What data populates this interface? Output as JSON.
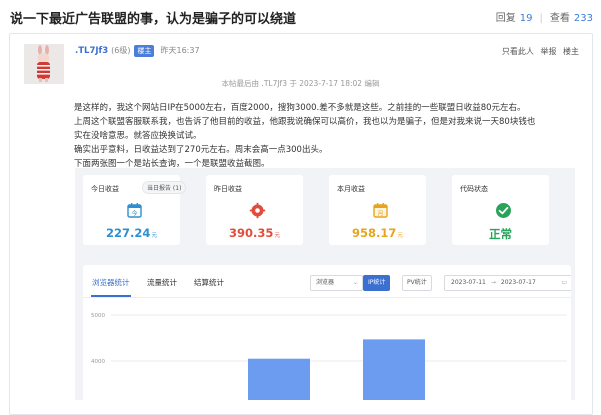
{
  "thread": {
    "title": "说一下最近广告联盟的事，认为是骗子的可以绕道",
    "replies_label": "回复",
    "replies": "19",
    "views_label": "查看",
    "views": "233"
  },
  "post": {
    "author": ".TL7Jf3",
    "level": "(6级)",
    "op_badge": "楼主",
    "time": "昨天16:37",
    "actions": [
      "只看此人",
      "举报",
      "楼主"
    ],
    "edit_note": "本帖最后由 .TL7Jf3 于 2023-7-17 18:02 编辑",
    "lines": [
      "是这样的，我这个网站日IP在5000左右，百度2000，搜狗3000.差不多就是这些。之前挂的一些联盟日收益80元左右。",
      "上周这个联盟客服联系我，也告诉了他目前的收益，他跟我说确保可以高价，我也以为是骗子，但是对我来说一天80块钱也",
      "实在没啥意思。就答应换换试试。",
      "确实出乎意料，日收益达到了270元左右。周末会高一点300出头。",
      "下面两张图一个是站长查询，一个是联盟收益截图。"
    ]
  },
  "dashboard": {
    "cards": [
      {
        "label": "今日收益",
        "chip": "当日报告 (1)",
        "value": "227.24",
        "unit": "元",
        "color": "#2f8fd0",
        "icon": "calendar-today-icon"
      },
      {
        "label": "昨日收益",
        "chip": "",
        "value": "390.35",
        "unit": "元",
        "color": "#e24c3a",
        "icon": "refresh-gear-icon"
      },
      {
        "label": "本月收益",
        "chip": "",
        "value": "958.17",
        "unit": "元",
        "color": "#e7a51d",
        "icon": "calendar-month-icon"
      },
      {
        "label": "代码状态",
        "chip": "",
        "value": "正常",
        "unit": "",
        "color": "#2aa35a",
        "icon": "check-circle-icon"
      }
    ],
    "tabs": [
      "浏览器统计",
      "流量统计",
      "结算统计"
    ],
    "active_tab": "浏览器统计",
    "browser_select": "浏览器",
    "ip_button": "IP统计",
    "pv_button": "PV统计",
    "date_from": "2023-07-11",
    "date_to": "2023-07-17"
  },
  "chart_data": {
    "type": "bar",
    "y_ticks": [
      "5000",
      "4000"
    ],
    "ylim": [
      3200,
      5000
    ],
    "values": [
      4050,
      4470
    ],
    "note": "only the top portion of two bars is visible; chart cut off at bottom",
    "bar_color": "#6c9cf0"
  }
}
